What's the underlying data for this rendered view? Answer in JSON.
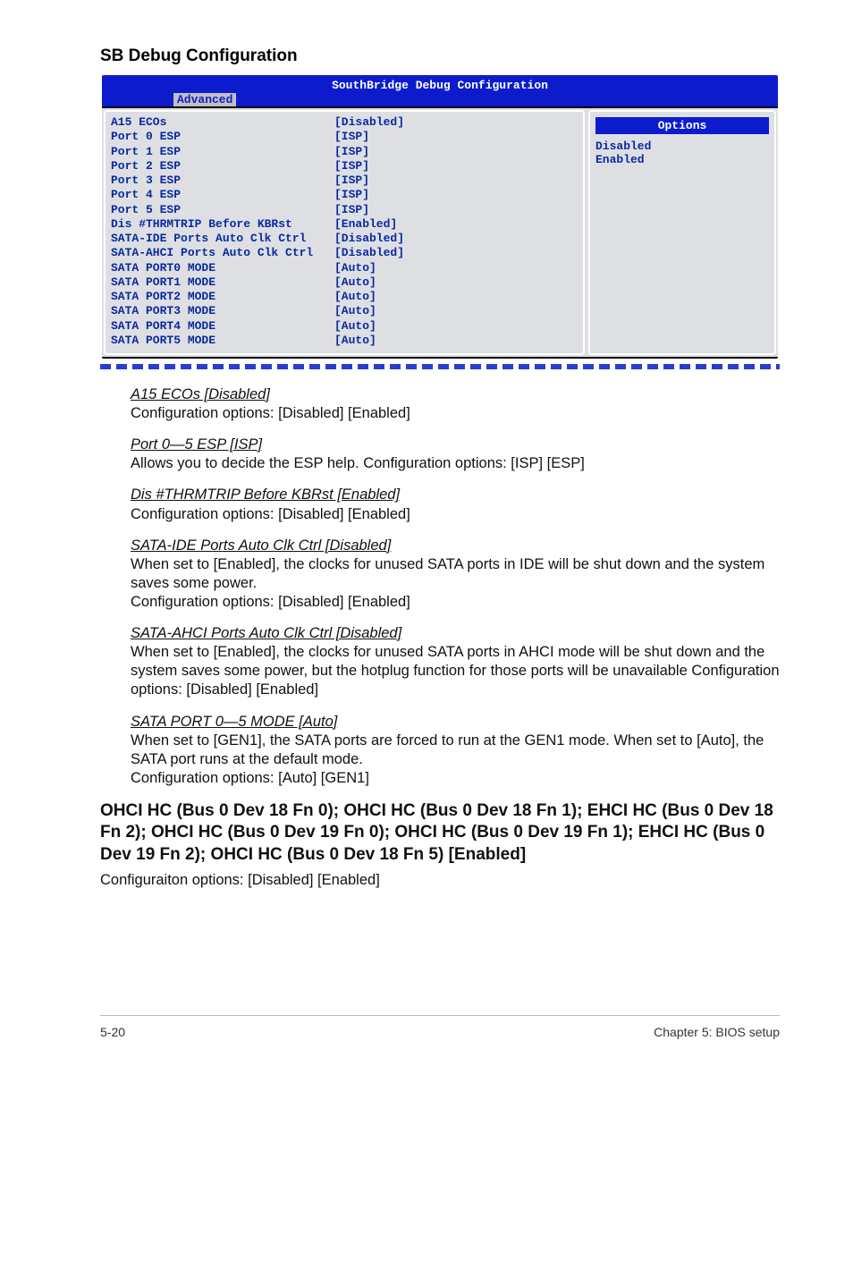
{
  "heading_sb": "SB Debug Configuration",
  "bios": {
    "title": "SouthBridge Debug Configuration",
    "tab": "Advanced",
    "options_label": "Options",
    "opt1": "Disabled",
    "opt2": "Enabled",
    "rows": [
      {
        "label": "A15 ECOs",
        "value": "[Disabled]"
      },
      {
        "label": "Port 0 ESP",
        "value": "[ISP]"
      },
      {
        "label": "Port 1 ESP",
        "value": "[ISP]"
      },
      {
        "label": "Port 2 ESP",
        "value": "[ISP]"
      },
      {
        "label": "Port 3 ESP",
        "value": "[ISP]"
      },
      {
        "label": "Port 4 ESP",
        "value": "[ISP]"
      },
      {
        "label": "Port 5 ESP",
        "value": "[ISP]"
      },
      {
        "label": "Dis #THRMTRIP Before KBRst",
        "value": "[Enabled]"
      },
      {
        "label": "SATA-IDE Ports Auto Clk Ctrl",
        "value": "[Disabled]"
      },
      {
        "label": "SATA-AHCI Ports Auto Clk Ctrl",
        "value": "[Disabled]"
      },
      {
        "label": "SATA PORT0 MODE",
        "value": "[Auto]"
      },
      {
        "label": "SATA PORT1 MODE",
        "value": "[Auto]"
      },
      {
        "label": "SATA PORT2 MODE",
        "value": "[Auto]"
      },
      {
        "label": "SATA PORT3 MODE",
        "value": "[Auto]"
      },
      {
        "label": "SATA PORT4 MODE",
        "value": "[Auto]"
      },
      {
        "label": "SATA PORT5 MODE",
        "value": "[Auto]"
      }
    ]
  },
  "sections": {
    "s1t": "A15 ECOs [Disabled]",
    "s1b": "Configuration options: [Disabled] [Enabled]",
    "s2t": "Port 0—5 ESP [ISP]",
    "s2b": "Allows you to decide the ESP help. Configuration options: [ISP] [ESP]",
    "s3t": "Dis #THRMTRIP Before KBRst [Enabled]",
    "s3b": "Configuration options: [Disabled] [Enabled]",
    "s4t": "SATA-IDE Ports Auto Clk Ctrl [Disabled]",
    "s4b1": "When set to [Enabled], the clocks for unused SATA ports in IDE will be shut down and the system saves some power.",
    "s4b2": "Configuration options: [Disabled] [Enabled]",
    "s5t": "SATA-AHCI Ports Auto Clk Ctrl [Disabled]",
    "s5b": "When set to [Enabled], the clocks for unused SATA ports in AHCI mode will be shut down and the system saves some power, but the hotplug function for those ports will be unavailable Configuration options: [Disabled] [Enabled]",
    "s6t": "SATA PORT 0—5 MODE [Auto]",
    "s6b1": "When set to [GEN1], the SATA ports are forced to run at the GEN1 mode. When set to [Auto], the SATA port runs at the default mode.",
    "s6b2": "Configuration options: [Auto] [GEN1]"
  },
  "big_heading": "OHCI HC (Bus 0 Dev 18 Fn 0); OHCI HC (Bus 0 Dev 18 Fn 1); EHCI HC (Bus 0 Dev 18 Fn 2); OHCI HC (Bus 0 Dev 19 Fn 0); OHCI HC (Bus 0 Dev 19 Fn 1); EHCI HC (Bus 0 Dev 19 Fn 2); OHCI HC (Bus 0 Dev 18 Fn 5) [Enabled]",
  "big_body": "Configuraiton options: [Disabled] [Enabled]",
  "footer_left": "5-20",
  "footer_right": "Chapter 5: BIOS setup"
}
